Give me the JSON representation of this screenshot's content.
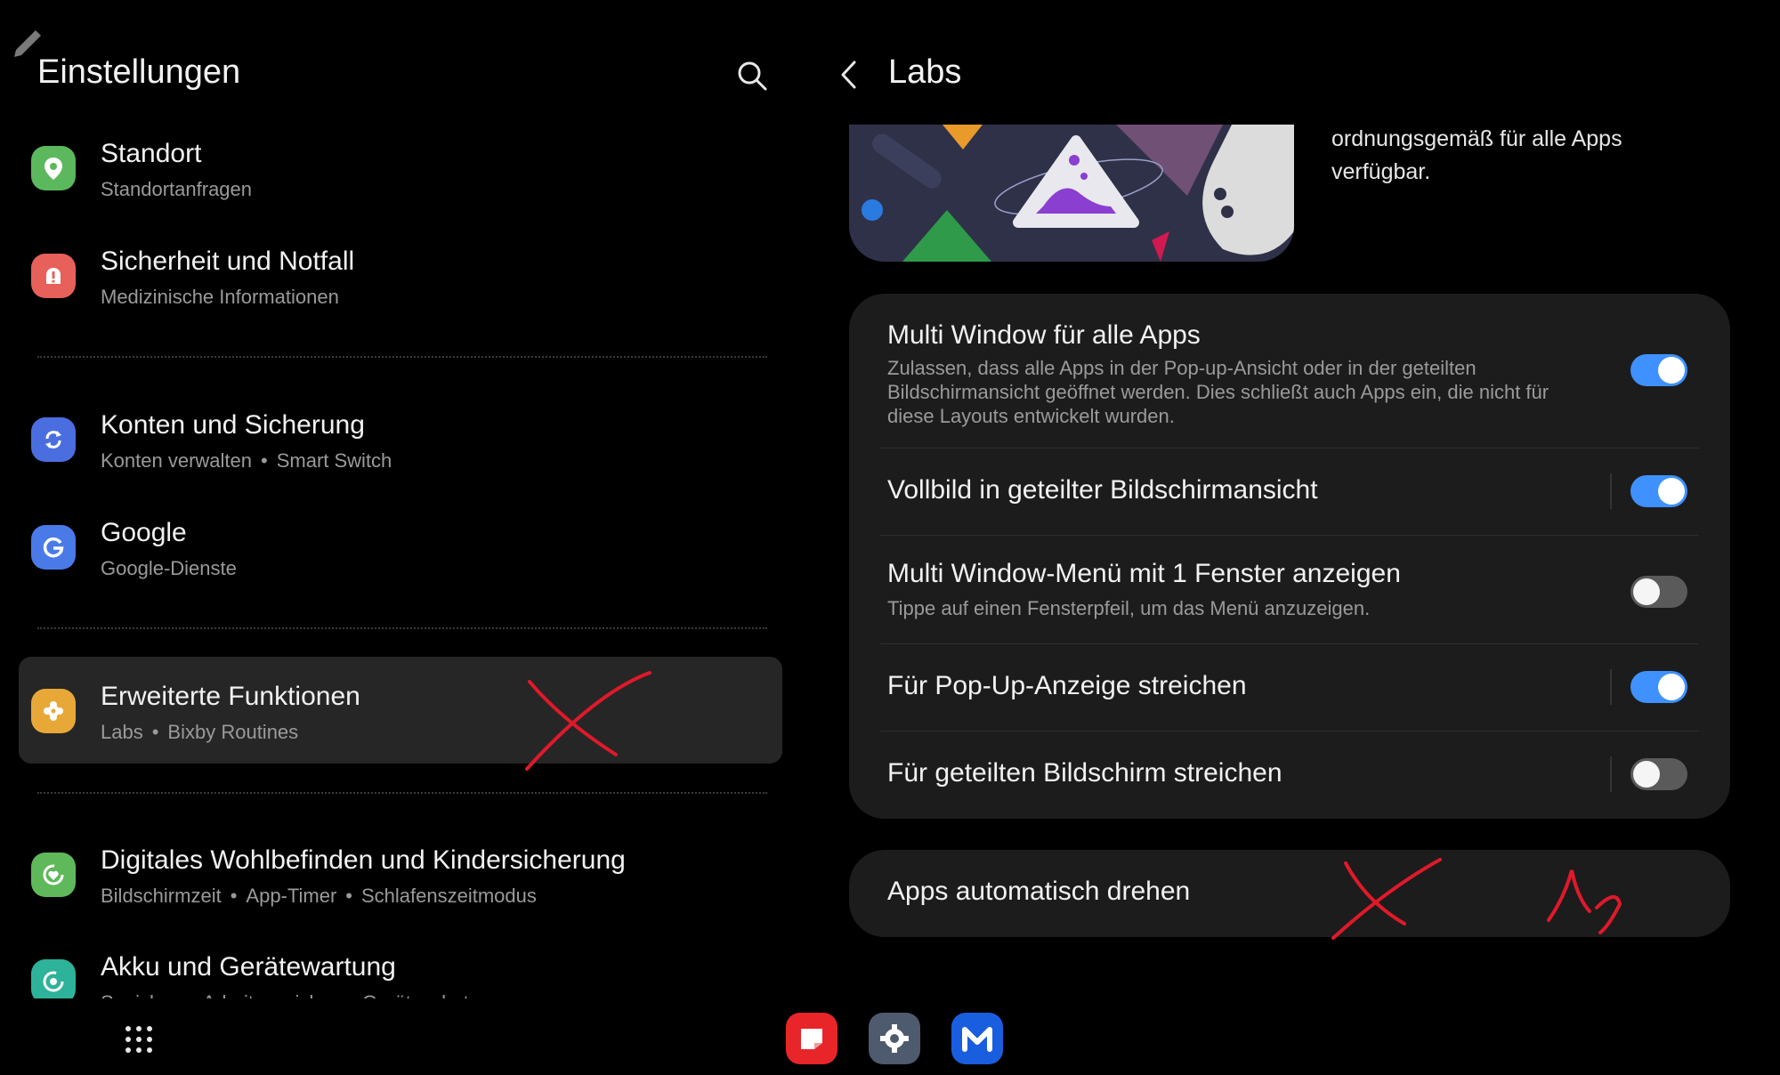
{
  "settings": {
    "title": "Einstellungen",
    "items": [
      {
        "title": "Standort",
        "sub": [
          "Standortanfragen"
        ],
        "icon": "location-pin-icon",
        "color": "#5cb85c"
      },
      {
        "title": "Sicherheit und Notfall",
        "sub": [
          "Medizinische Informationen"
        ],
        "icon": "alert-icon",
        "color": "#e8605a"
      },
      {
        "title": "Konten und Sicherung",
        "sub": [
          "Konten verwalten",
          "Smart Switch"
        ],
        "icon": "sync-icon",
        "color": "#4a6ee0"
      },
      {
        "title": "Google",
        "sub": [
          "Google-Dienste"
        ],
        "icon": "google-icon",
        "color": "#4a7ae8"
      },
      {
        "title": "Erweiterte Funktionen",
        "sub": [
          "Labs",
          "Bixby Routines"
        ],
        "icon": "puzzle-icon",
        "color": "#e8a838",
        "selected": true
      },
      {
        "title": "Digitales Wohlbefinden und Kindersicherung",
        "sub": [
          "Bildschirmzeit",
          "App-Timer",
          "Schlafenszeitmodus"
        ],
        "icon": "wellbeing-icon",
        "color": "#5fb85a"
      },
      {
        "title": "Akku und Gerätewartung",
        "sub": [
          "Speicher",
          "Arbeitsspeicher",
          "Geräteschutz"
        ],
        "icon": "device-care-icon",
        "color": "#2db39a"
      }
    ]
  },
  "labs": {
    "title": "Labs",
    "intro_text": "ordnungsgemäß für alle Apps verfügbar.",
    "options": [
      {
        "title": "Multi Window für alle Apps",
        "desc": "Zulassen, dass alle Apps in der Pop-up-Ansicht oder in der geteilten Bildschirmansicht geöffnet werden. Dies schließt auch Apps ein, die nicht für diese Layouts entwickelt wurden.",
        "on": true
      },
      {
        "title": "Vollbild in geteilter Bildschirmansicht",
        "desc": "",
        "on": true
      },
      {
        "title": "Multi Window-Menü mit 1 Fenster anzeigen",
        "desc": "Tippe auf einen Fensterpfeil, um das Menü anzuzeigen.",
        "on": false
      },
      {
        "title": "Für Pop-Up-Anzeige streichen",
        "desc": "",
        "on": true
      },
      {
        "title": "Für geteilten Bildschirm streichen",
        "desc": "",
        "on": false
      }
    ],
    "extra": {
      "title": "Apps automatisch drehen"
    }
  },
  "colors": {
    "accent": "#3e91ff",
    "background": "#000000",
    "card": "#1c1c1c",
    "selected": "#262626",
    "annotation": "#e0192a"
  },
  "dock": [
    "apps-grid-icon",
    "samsung-notes-icon",
    "settings-gear-icon",
    "multistar-icon"
  ]
}
